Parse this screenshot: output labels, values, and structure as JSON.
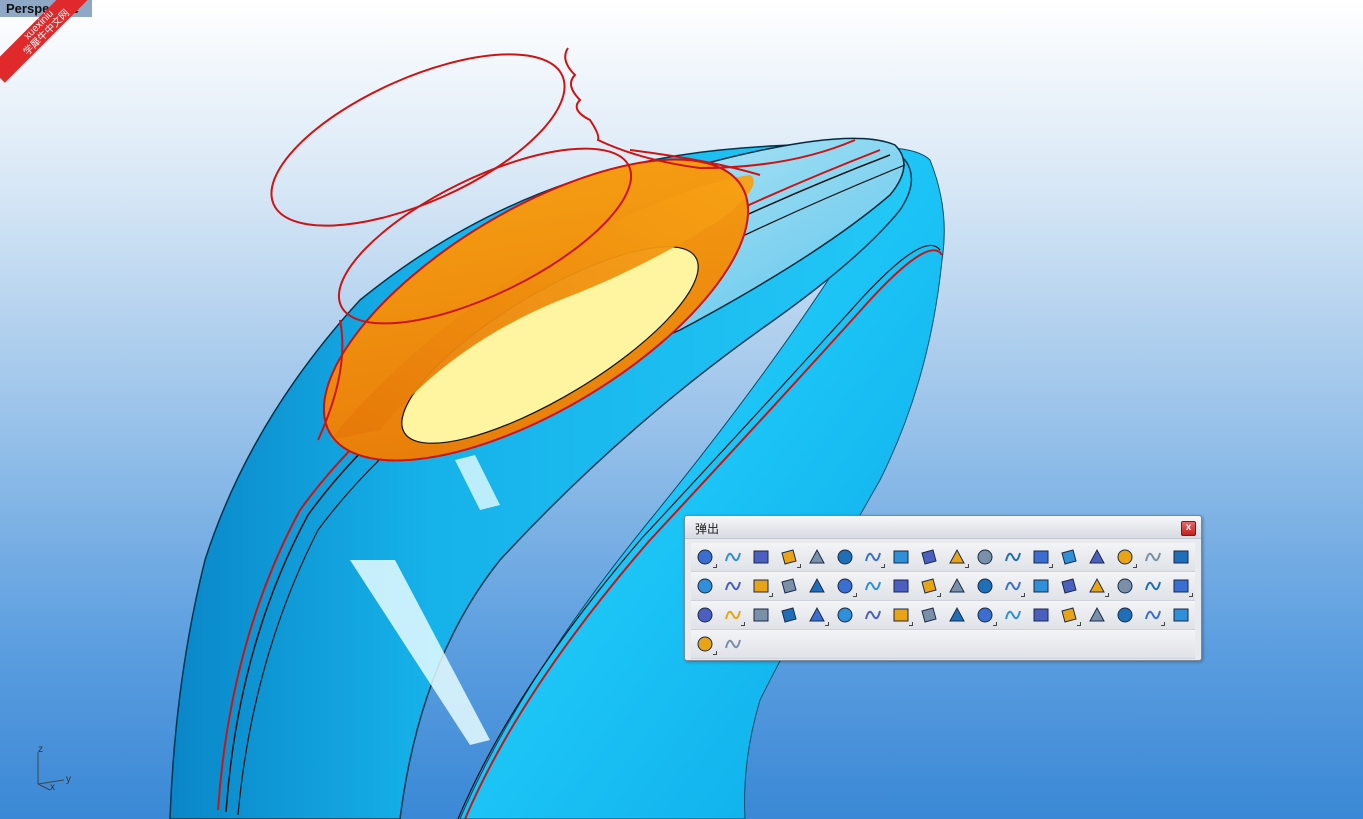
{
  "viewport": {
    "label": "Perspective",
    "axes": {
      "z": "z",
      "x": "x",
      "y": "y"
    }
  },
  "watermark": {
    "line1": "xuexiniu",
    "line2": "学犀牛中文网"
  },
  "popup": {
    "title": "弹出",
    "close_glyph": "x",
    "rows": [
      [
        "light-bulb-icon",
        "lock-icon",
        "save-icon",
        "zoom-extents-icon",
        "wireframe-sphere-icon",
        "render-sphere-icon",
        "color-wheel-icon",
        "gear-settings-icon",
        "explode-icon",
        "revolve-curve-icon",
        "surface-patch-icon",
        "network-surface-icon",
        "blend-surface-icon",
        "sweep1-icon",
        "sweep2-icon",
        "points-ring-icon",
        "arch-icon",
        "rail-revolve-icon"
      ],
      [
        "mirror-icon",
        "array-icon",
        "gumball-icon",
        "extrude-surface-icon",
        "polyline-icon",
        "circle-point-icon",
        "layers-stack-icon",
        "cylinder-cap-icon",
        "plane-surface-icon",
        "planar-surface-icon",
        "circle-center-icon",
        "box-solid-icon",
        "sphere-icon",
        "boolean-union-icon",
        "boolean-difference-icon",
        "boolean-intersect-icon",
        "dimension-icon",
        "ellipse-solid-icon"
      ],
      [
        "cube-icon",
        "curve-bend-icon",
        "curve-blend-icon",
        "arc-icon",
        "walk-person-icon",
        "polyline-2-icon",
        "vertical-points-icon",
        "cylinder-solid-icon",
        "grid-points-icon",
        "fillet-edge-icon",
        "tube-icon",
        "cylinder-icon",
        "pie-solid-icon",
        "half-moon-icon",
        "shell-icon",
        "pipe-icon",
        "cap-tube-icon",
        "twist-surface-icon"
      ],
      [
        "flag-surface-icon",
        "loft-surface-icon"
      ]
    ]
  },
  "colors": {
    "curve_red": "#cc1414",
    "body_cyan": "#1ec0f0",
    "orange_face": "#f08a10",
    "yellow_face": "#fff59a"
  }
}
